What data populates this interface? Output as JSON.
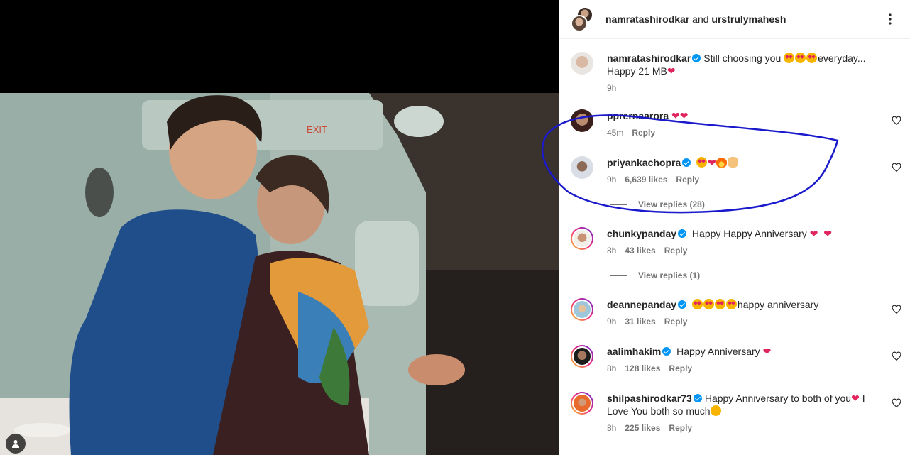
{
  "post": {
    "author_1": "namratashirodkar",
    "connector": "and",
    "author_2": "urstrulymahesh"
  },
  "caption": {
    "user": "namratashirodkar",
    "text_1": "Still choosing you",
    "text_2": "everyday...",
    "text_3": "Happy 21 MB",
    "time": "9h"
  },
  "comments": [
    {
      "user": "pprernaarora",
      "text": "",
      "time": "45m",
      "likes": "",
      "reply": "Reply"
    },
    {
      "user": "priyankachopra",
      "text": "",
      "time": "9h",
      "likes": "6,639 likes",
      "reply": "Reply",
      "view_replies": "View replies (28)"
    },
    {
      "user": "chunkypanday",
      "text": "Happy Happy Anniversary",
      "time": "8h",
      "likes": "43 likes",
      "reply": "Reply",
      "view_replies": "View replies (1)"
    },
    {
      "user": "deannepanday",
      "text": "happy anniversary",
      "time": "9h",
      "likes": "31 likes",
      "reply": "Reply"
    },
    {
      "user": "aalimhakim",
      "text": "Happy Anniversary",
      "time": "8h",
      "likes": "128 likes",
      "reply": "Reply"
    },
    {
      "user": "shilpashirodkar73",
      "text_1": "Happy Anniversary to both of you",
      "text_2": "I",
      "text_3": "Love You both so much",
      "time": "8h",
      "likes": "225 likes",
      "reply": "Reply"
    }
  ],
  "overlay_mark": "EXIT",
  "colors": {
    "verified": "#0095f6",
    "annotation": "#1a1acc",
    "heart": "#e0245e"
  },
  "icons": [
    "more-options-icon",
    "heart-outline-icon",
    "verified-badge-icon",
    "user-tag-icon"
  ]
}
